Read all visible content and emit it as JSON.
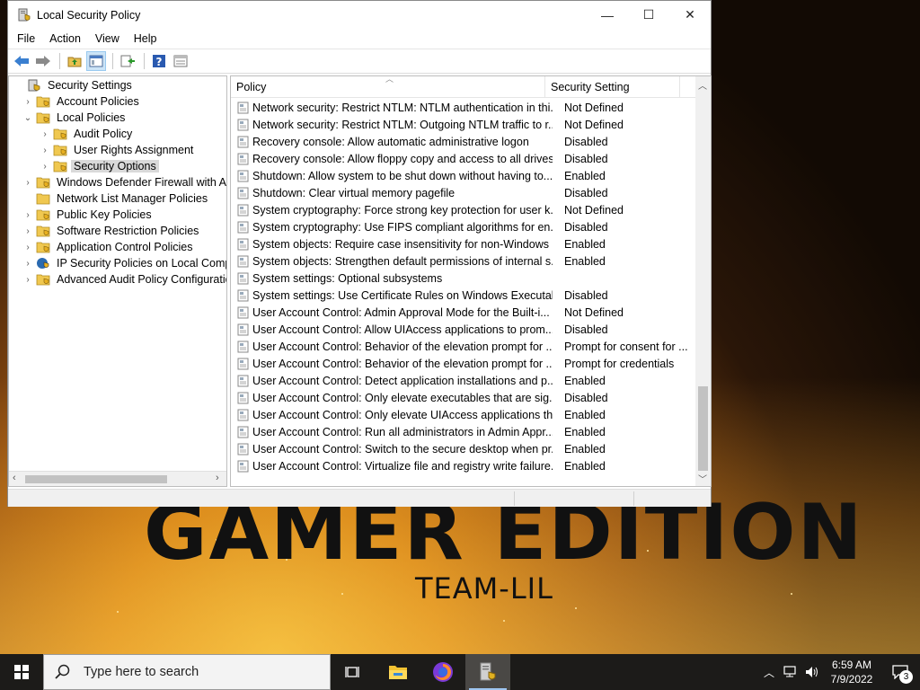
{
  "desktop": {
    "brand_big": "GAMER EDITION",
    "brand_small": "TEAM-LIL"
  },
  "window": {
    "title": "Local Security Policy",
    "controls": [
      "—",
      "☐",
      "✕"
    ]
  },
  "menu": [
    "File",
    "Action",
    "View",
    "Help"
  ],
  "toolbar": [
    "back-icon",
    "forward-icon",
    "up-folder-icon",
    "show-hide-tree-icon",
    "export-list-icon",
    "help-icon",
    "properties-icon"
  ],
  "tree": [
    {
      "label": "Security Settings",
      "level": 0,
      "arrow": "",
      "icon": "security-settings"
    },
    {
      "label": "Account Policies",
      "level": 1,
      "arrow": "›",
      "icon": "folder"
    },
    {
      "label": "Local Policies",
      "level": 1,
      "arrow": "⌄",
      "icon": "folder"
    },
    {
      "label": "Audit Policy",
      "level": 2,
      "arrow": "›",
      "icon": "folder"
    },
    {
      "label": "User Rights Assignment",
      "level": 2,
      "arrow": "›",
      "icon": "folder"
    },
    {
      "label": "Security Options",
      "level": 2,
      "arrow": "›",
      "icon": "folder",
      "selected": true
    },
    {
      "label": "Windows Defender Firewall with Adva",
      "level": 1,
      "arrow": "›",
      "icon": "folder"
    },
    {
      "label": "Network List Manager Policies",
      "level": 1,
      "arrow": "",
      "icon": "folder"
    },
    {
      "label": "Public Key Policies",
      "level": 1,
      "arrow": "›",
      "icon": "folder"
    },
    {
      "label": "Software Restriction Policies",
      "level": 1,
      "arrow": "›",
      "icon": "folder"
    },
    {
      "label": "Application Control Policies",
      "level": 1,
      "arrow": "›",
      "icon": "folder"
    },
    {
      "label": "IP Security Policies on Local Compute",
      "level": 1,
      "arrow": "›",
      "icon": "ipsec"
    },
    {
      "label": "Advanced Audit Policy Configuration",
      "level": 1,
      "arrow": "›",
      "icon": "folder"
    }
  ],
  "list": {
    "columns": [
      "Policy",
      "Security Setting"
    ],
    "rows": [
      {
        "policy": "Network security: Restrict NTLM: NTLM authentication in thi...",
        "setting": "Not Defined"
      },
      {
        "policy": "Network security: Restrict NTLM: Outgoing NTLM traffic to r...",
        "setting": "Not Defined"
      },
      {
        "policy": "Recovery console: Allow automatic administrative logon",
        "setting": "Disabled"
      },
      {
        "policy": "Recovery console: Allow floppy copy and access to all drives...",
        "setting": "Disabled"
      },
      {
        "policy": "Shutdown: Allow system to be shut down without having to...",
        "setting": "Enabled"
      },
      {
        "policy": "Shutdown: Clear virtual memory pagefile",
        "setting": "Disabled"
      },
      {
        "policy": "System cryptography: Force strong key protection for user k...",
        "setting": "Not Defined"
      },
      {
        "policy": "System cryptography: Use FIPS compliant algorithms for en...",
        "setting": "Disabled"
      },
      {
        "policy": "System objects: Require case insensitivity for non-Windows ...",
        "setting": "Enabled"
      },
      {
        "policy": "System objects: Strengthen default permissions of internal s...",
        "setting": "Enabled"
      },
      {
        "policy": "System settings: Optional subsystems",
        "setting": ""
      },
      {
        "policy": "System settings: Use Certificate Rules on Windows Executab...",
        "setting": "Disabled"
      },
      {
        "policy": "User Account Control: Admin Approval Mode for the Built-i...",
        "setting": "Not Defined"
      },
      {
        "policy": "User Account Control: Allow UIAccess applications to prom...",
        "setting": "Disabled"
      },
      {
        "policy": "User Account Control: Behavior of the elevation prompt for ...",
        "setting": "Prompt for consent for ..."
      },
      {
        "policy": "User Account Control: Behavior of the elevation prompt for ...",
        "setting": "Prompt for credentials"
      },
      {
        "policy": "User Account Control: Detect application installations and p...",
        "setting": "Enabled"
      },
      {
        "policy": "User Account Control: Only elevate executables that are sig...",
        "setting": "Disabled"
      },
      {
        "policy": "User Account Control: Only elevate UIAccess applications th...",
        "setting": "Enabled"
      },
      {
        "policy": "User Account Control: Run all administrators in Admin Appr...",
        "setting": "Enabled"
      },
      {
        "policy": "User Account Control: Switch to the secure desktop when pr...",
        "setting": "Enabled"
      },
      {
        "policy": "User Account Control: Virtualize file and registry write failure...",
        "setting": "Enabled"
      }
    ]
  },
  "taskbar": {
    "search_placeholder": "Type here to search",
    "apps": [
      "task-view-icon",
      "file-explorer-icon",
      "firefox-icon",
      "local-security-policy-icon"
    ],
    "time": "6:59 AM",
    "date": "7/9/2022",
    "notification_count": "3"
  }
}
